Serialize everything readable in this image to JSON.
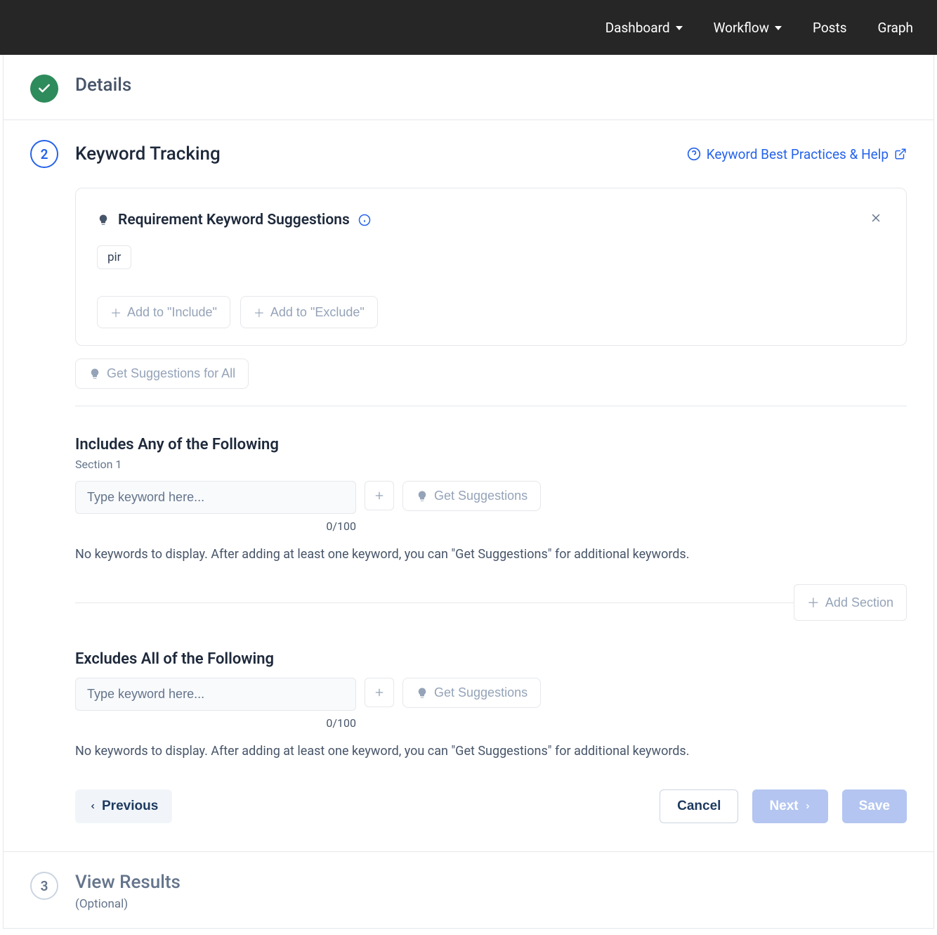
{
  "topnav": {
    "dashboard": "Dashboard",
    "workflow": "Workflow",
    "posts": "Posts",
    "graph": "Graph"
  },
  "step1": {
    "title": "Details"
  },
  "step2": {
    "number": "2",
    "title": "Keyword Tracking",
    "help_link": "Keyword Best Practices & Help"
  },
  "suggestions": {
    "title": "Requirement Keyword Suggestions",
    "tag1": "pir",
    "add_include": "Add to \"Include\"",
    "add_exclude": "Add to \"Exclude\"",
    "get_all": "Get Suggestions for All"
  },
  "includes": {
    "heading": "Includes Any of the Following",
    "section_label": "Section 1",
    "placeholder": "Type keyword here...",
    "counter": "0/100",
    "get_suggestions": "Get Suggestions",
    "empty_text": "No keywords to display. After adding at least one keyword, you can \"Get Suggestions\" for additional keywords.",
    "add_section": "Add Section"
  },
  "excludes": {
    "heading": "Excludes All of the Following",
    "placeholder": "Type keyword here...",
    "counter": "0/100",
    "get_suggestions": "Get Suggestions",
    "empty_text": "No keywords to display. After adding at least one keyword, you can \"Get Suggestions\" for additional keywords."
  },
  "footer": {
    "previous": "Previous",
    "cancel": "Cancel",
    "next": "Next",
    "save": "Save"
  },
  "step3": {
    "number": "3",
    "title": "View Results",
    "sub": "(Optional)"
  }
}
